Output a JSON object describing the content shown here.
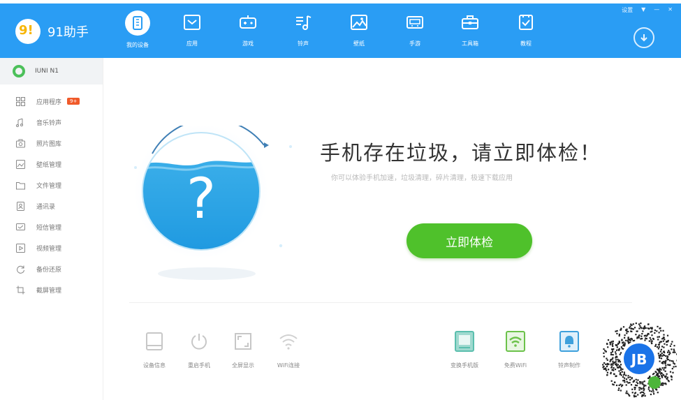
{
  "app": {
    "name": "91助手",
    "logo_text": "9!",
    "accent": "#2a9df4",
    "button_green": "#4fc12b"
  },
  "window_controls": [
    "设置",
    "▼",
    "—",
    "✕"
  ],
  "nav": [
    {
      "label": "我的设备",
      "icon": "device-icon",
      "active": true
    },
    {
      "label": "应用",
      "icon": "app-store-icon"
    },
    {
      "label": "游戏",
      "icon": "gamepad-icon"
    },
    {
      "label": "铃声",
      "icon": "music-note-icon"
    },
    {
      "label": "壁纸",
      "icon": "image-icon"
    },
    {
      "label": "手游",
      "icon": "handheld-game-icon"
    },
    {
      "label": "工具箱",
      "icon": "toolbox-icon"
    },
    {
      "label": "教程",
      "icon": "tutorial-icon"
    }
  ],
  "sidebar": {
    "device_name": "IUNI N1",
    "items": [
      {
        "label": "应用程序",
        "icon": "grid-icon",
        "badge": "9+"
      },
      {
        "label": "音乐铃声",
        "icon": "music-icon"
      },
      {
        "label": "照片图库",
        "icon": "camera-icon"
      },
      {
        "label": "壁纸管理",
        "icon": "wallpaper-icon"
      },
      {
        "label": "文件管理",
        "icon": "folder-icon"
      },
      {
        "label": "通讯录",
        "icon": "contacts-icon"
      },
      {
        "label": "短信管理",
        "icon": "sms-icon"
      },
      {
        "label": "视频管理",
        "icon": "video-icon"
      },
      {
        "label": "备份还原",
        "icon": "refresh-icon"
      },
      {
        "label": "截屏管理",
        "icon": "crop-icon"
      }
    ]
  },
  "main": {
    "orb_symbol": "?",
    "headline": "手机存在垃圾，请立即体检！",
    "subline": "你可以体验手机加速，垃圾清理，碎片清理，极速下载应用",
    "check_button": "立即体检"
  },
  "tools_left": [
    {
      "label": "设备信息",
      "icon": "tablet-icon"
    },
    {
      "label": "重启手机",
      "icon": "power-icon"
    },
    {
      "label": "全屏显示",
      "icon": "fullscreen-icon"
    },
    {
      "label": "WiFi连接",
      "icon": "wifi-icon"
    }
  ],
  "tools_right": [
    {
      "label": "变换手机版",
      "icon": "phone-screen-icon"
    },
    {
      "label": "免费WiFi",
      "icon": "free-wifi-icon"
    },
    {
      "label": "铃声制作",
      "icon": "bell-icon"
    }
  ],
  "qr_badge_text": "JB"
}
